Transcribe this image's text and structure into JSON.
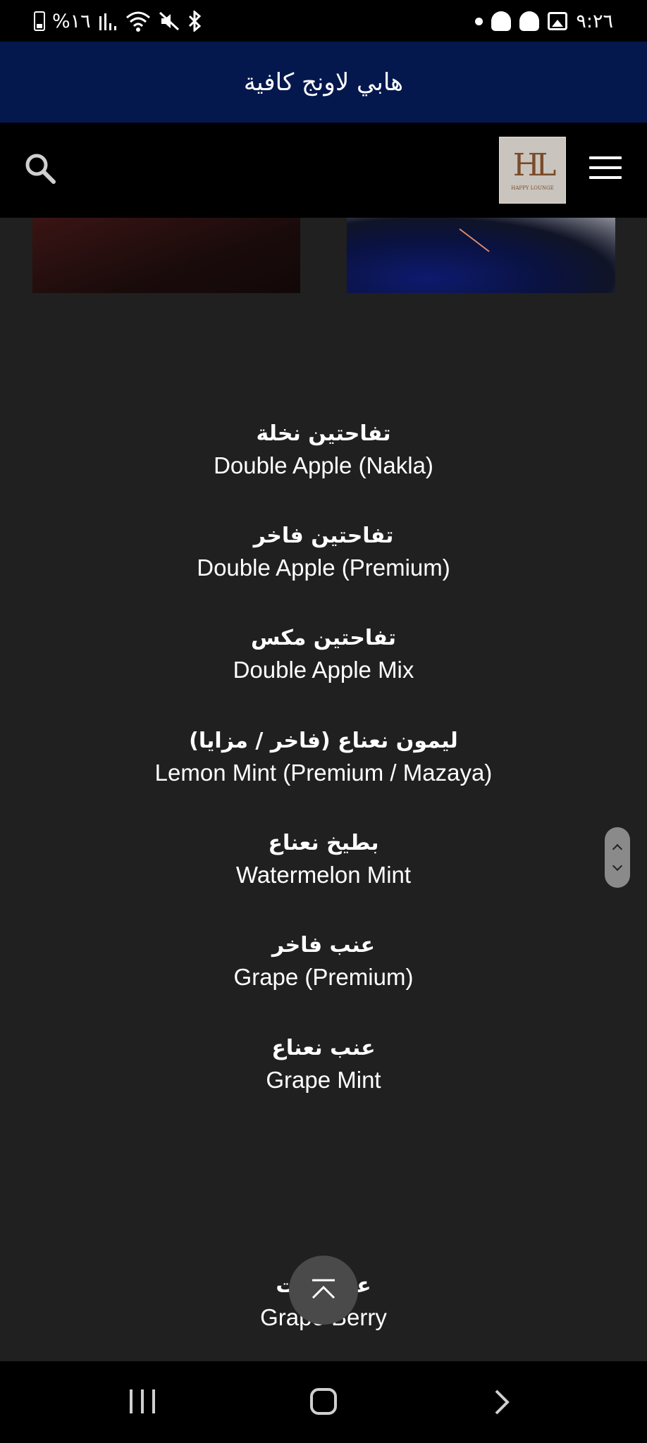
{
  "status_bar": {
    "battery_percent": "%١٦",
    "time": "٩:٢٦"
  },
  "banner": {
    "title": "هابي لاونج كافية"
  },
  "header": {
    "logo_text": "HL",
    "logo_subtext": "HAPPY LOUNGE"
  },
  "menu": {
    "items": [
      {
        "ar": "تفاحتين نخلة",
        "en": "Double Apple (Nakla)"
      },
      {
        "ar": "تفاحتين فاخر",
        "en": "Double Apple (Premium)"
      },
      {
        "ar": "تفاحتين مكس",
        "en": "Double Apple Mix"
      },
      {
        "ar": "ليمون نعناع (فاخر / مزايا)",
        "en": "Lemon Mint (Premium / Mazaya)"
      },
      {
        "ar": "بطيخ نعناع",
        "en": "Watermelon Mint"
      },
      {
        "ar": "عنب فاخر",
        "en": "Grape (Premium)"
      },
      {
        "ar": "عنب نعناع",
        "en": "Grape Mint"
      },
      {
        "ar": "عنب توت",
        "en": "Grape Berry"
      }
    ]
  },
  "colors": {
    "banner_bg": "#05184d",
    "page_bg": "#202020",
    "header_bg": "#000000"
  }
}
